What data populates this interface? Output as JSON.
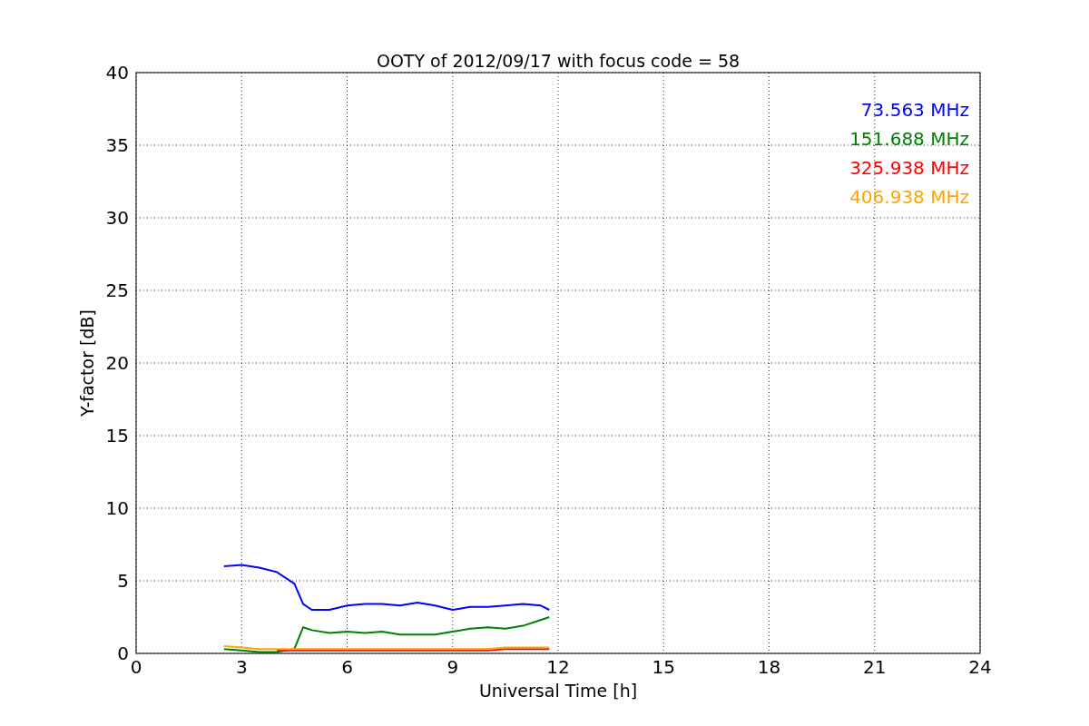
{
  "figure": {
    "chart_data": {
      "type": "line",
      "title": "OOTY of 2012/09/17 with focus code = 58",
      "xlabel": "Universal Time [h]",
      "ylabel": "Y-factor [dB]",
      "x": [
        2.5,
        3,
        3.5,
        4,
        4.5,
        4.75,
        5,
        5.5,
        6,
        6.5,
        7,
        7.5,
        8,
        8.5,
        9,
        9.5,
        10,
        10.5,
        11,
        11.5,
        11.75
      ],
      "series": [
        {
          "name": "73.563 MHz",
          "color": "#0000ff",
          "values": [
            6.0,
            6.1,
            5.9,
            5.6,
            4.8,
            3.4,
            3.0,
            3.0,
            3.3,
            3.4,
            3.4,
            3.3,
            3.5,
            3.3,
            3.0,
            3.2,
            3.2,
            3.3,
            3.4,
            3.3,
            3.0
          ]
        },
        {
          "name": "151.688 MHz",
          "color": "#008000",
          "values": [
            0.3,
            0.2,
            0.1,
            0.1,
            0.3,
            1.8,
            1.6,
            1.4,
            1.5,
            1.4,
            1.5,
            1.3,
            1.3,
            1.3,
            1.5,
            1.7,
            1.8,
            1.7,
            1.9,
            2.3,
            2.5
          ]
        },
        {
          "name": "325.938 MHz",
          "color": "#ff0000",
          "values": [
            null,
            null,
            null,
            0.2,
            0.2,
            0.2,
            0.2,
            0.2,
            0.2,
            0.2,
            0.2,
            0.2,
            0.2,
            0.2,
            0.2,
            0.2,
            0.2,
            0.3,
            0.3,
            0.3,
            0.3
          ]
        },
        {
          "name": "406.938 MHz",
          "color": "#ffa500",
          "values": [
            0.5,
            0.4,
            0.3,
            0.3,
            0.3,
            0.3,
            0.3,
            0.3,
            0.3,
            0.3,
            0.3,
            0.3,
            0.3,
            0.3,
            0.3,
            0.3,
            0.3,
            0.4,
            0.4,
            0.4,
            0.4
          ]
        }
      ],
      "grid": true,
      "xlim": [
        0,
        24
      ],
      "ylim": [
        0,
        40
      ],
      "xticks": [
        0,
        3,
        6,
        9,
        12,
        15,
        18,
        21,
        24
      ],
      "yticks": [
        0,
        5,
        10,
        15,
        20,
        25,
        30,
        35,
        40
      ]
    }
  }
}
